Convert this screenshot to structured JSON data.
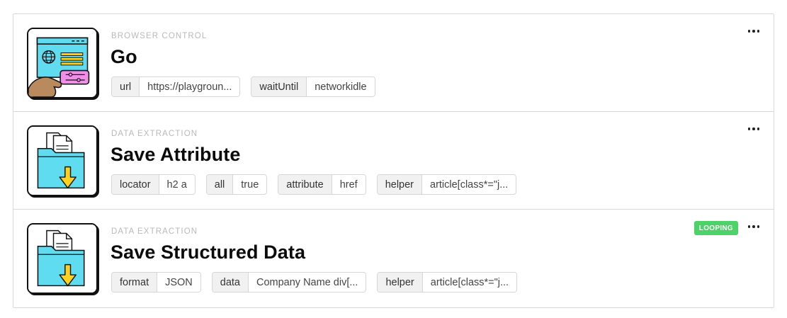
{
  "steps": [
    {
      "category": "BROWSER CONTROL",
      "title": "Go",
      "icon": "browser-hand-icon",
      "badge": null,
      "params": [
        {
          "key": "url",
          "value": "https://playgroun..."
        },
        {
          "key": "waitUntil",
          "value": "networkidle"
        }
      ]
    },
    {
      "category": "DATA EXTRACTION",
      "title": "Save Attribute",
      "icon": "folder-download-icon",
      "badge": null,
      "params": [
        {
          "key": "locator",
          "value": "h2 a"
        },
        {
          "key": "all",
          "value": "true"
        },
        {
          "key": "attribute",
          "value": "href"
        },
        {
          "key": "helper",
          "value": "article[class*=\"j..."
        }
      ]
    },
    {
      "category": "DATA EXTRACTION",
      "title": "Save Structured Data",
      "icon": "folder-download-icon",
      "badge": "LOOPING",
      "params": [
        {
          "key": "format",
          "value": "JSON"
        },
        {
          "key": "data",
          "value": "Company Name div[..."
        },
        {
          "key": "helper",
          "value": "article[class*=\"j..."
        }
      ]
    }
  ],
  "colors": {
    "badge_green": "#4cd267",
    "icon_cyan": "#5fdcf0",
    "icon_yellow": "#ffd21f",
    "icon_pink": "#f08ee8",
    "hand_brown": "#b98a5d"
  }
}
